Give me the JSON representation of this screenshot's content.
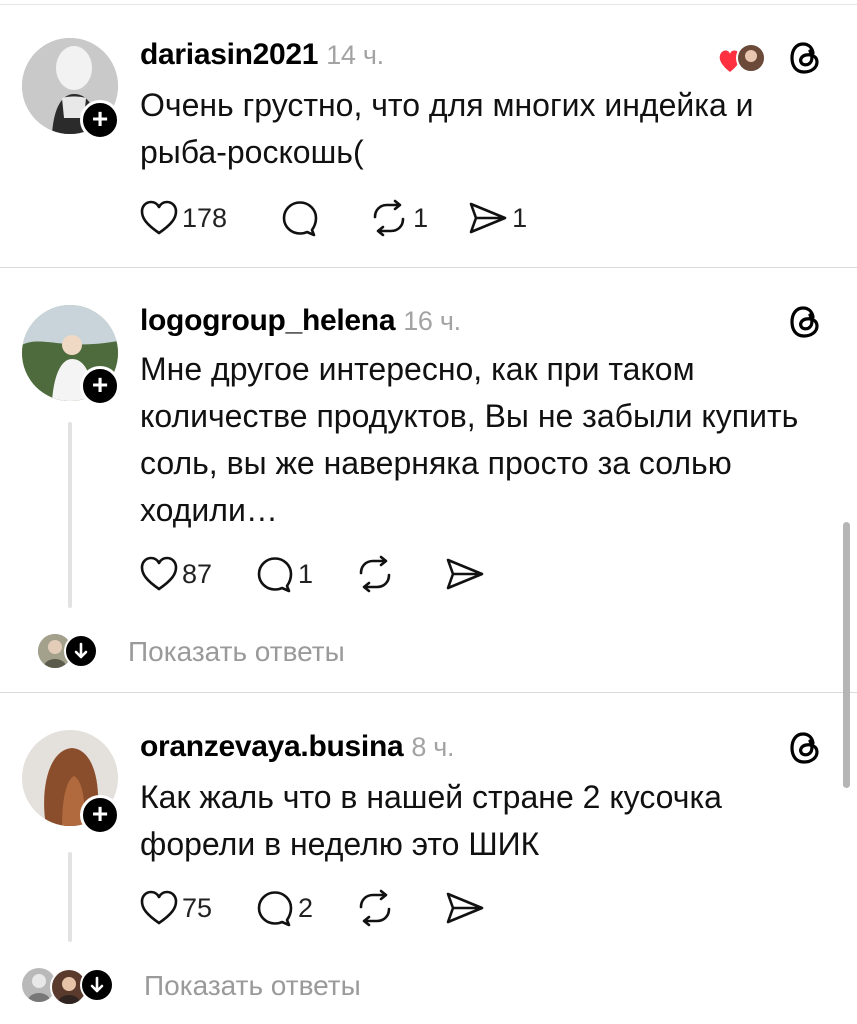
{
  "posts": [
    {
      "username": "dariasin2021",
      "time": "14 ч.",
      "text": "Очень грустно, что для многих индейка и рыба-роскошь(",
      "likes": "178",
      "comments": "",
      "reposts": "1",
      "shares": "1"
    },
    {
      "username": "logogroup_helena",
      "time": "16 ч.",
      "text": "Мне другое интересно, как при таком количестве продуктов, Вы не забыли купить соль, вы же наверняка просто за солью ходили…",
      "likes": "87",
      "comments": "1",
      "reposts": "",
      "shares": "",
      "show_replies": "Показать ответы"
    },
    {
      "username": "oranzevaya.busina",
      "time": "8 ч.",
      "text": "Как жаль что в нашей стране 2 кусочка форели в неделю это ШИК",
      "likes": "75",
      "comments": "2",
      "reposts": "",
      "shares": "",
      "show_replies": "Показать ответы"
    }
  ],
  "icons": {
    "like": "heart-icon",
    "comment": "comment-icon",
    "repost": "repost-icon",
    "share": "share-icon",
    "threads": "threads-icon",
    "follow": "plus-icon"
  },
  "colors": {
    "accent_heart": "#ff3040",
    "muted": "#9a9a9a",
    "divider": "#dbdbdb"
  }
}
